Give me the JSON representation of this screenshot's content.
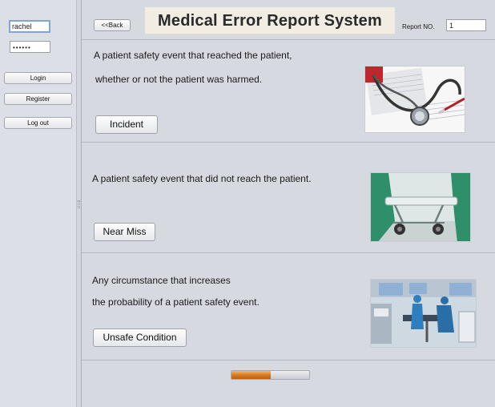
{
  "sidebar": {
    "username_value": "rachel",
    "password_value": "••••••",
    "login_label": "Login",
    "register_label": "Register",
    "logout_label": "Log out"
  },
  "header": {
    "back_label": "<<Back",
    "title": "Medical Error Report System",
    "report_no_label": "Report NO.",
    "report_no_value": "1"
  },
  "cases": [
    {
      "lines": [
        "A patient safety event that reached the patient,",
        "whether or not the patient was harmed."
      ],
      "button_label": "Incident",
      "image_icon": "stethoscope-photo"
    },
    {
      "lines": [
        "A patient safety event that did not reach the patient."
      ],
      "button_label": "Near Miss",
      "image_icon": "hospital-stretcher-photo"
    },
    {
      "lines": [
        "Any circumstance that increases",
        "the probability of a patient safety event."
      ],
      "button_label": "Unsafe Condition",
      "image_icon": "operating-room-photo"
    }
  ],
  "progress": {
    "value": 0.5
  },
  "colors": {
    "background": "#d6d9e0",
    "title_box": "#f1ede2",
    "progress_fill": "#d27a1f",
    "focus_border": "#7ea7d8"
  }
}
